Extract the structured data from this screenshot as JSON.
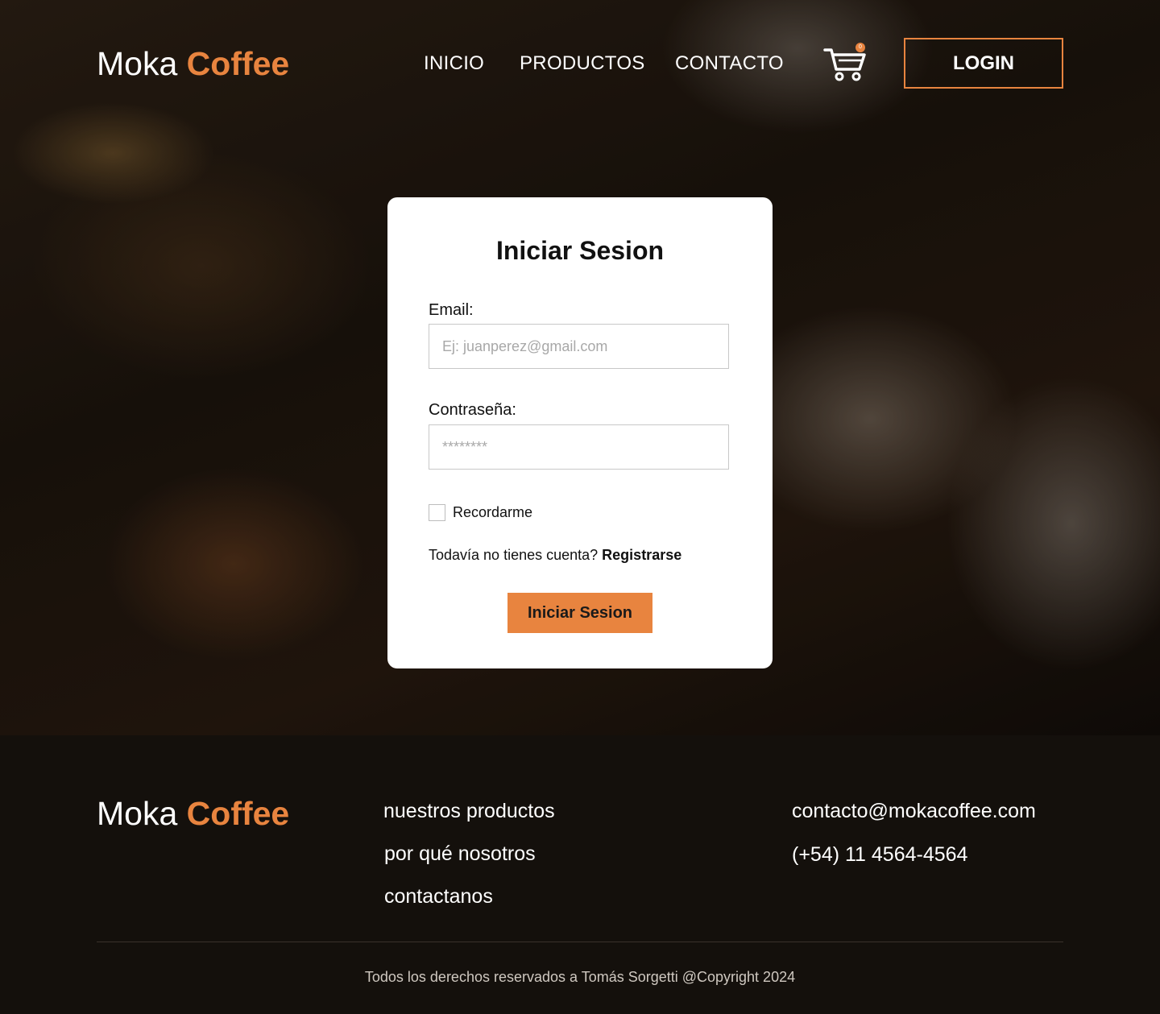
{
  "brand": {
    "word1": "Moka",
    "word2": "Coffee",
    "accent_color": "#e8843f"
  },
  "nav": {
    "items": [
      {
        "label": "INICIO"
      },
      {
        "label": "PRODUCTOS"
      },
      {
        "label": "CONTACTO"
      }
    ],
    "cart_icon": "cart-icon",
    "cart_count": "0",
    "login_label": "LOGIN"
  },
  "login": {
    "title": "Iniciar Sesion",
    "email_label": "Email:",
    "email_placeholder": "Ej: juanperez@gmail.com",
    "password_label": "Contraseña:",
    "password_placeholder": "********",
    "remember_label": "Recordarme",
    "no_account_text": "Todavía no tienes cuenta?",
    "register_link": "Registrarse",
    "submit_label": "Iniciar Sesion"
  },
  "footer": {
    "links": [
      {
        "label": "nuestros productos"
      },
      {
        "label": "por qué nosotros"
      },
      {
        "label": "contactanos"
      }
    ],
    "contact": {
      "email": "contacto@mokacoffee.com",
      "phone": "(+54) 11 4564-4564"
    },
    "copyright": "Todos los derechos reservados a Tomás Sorgetti @Copyright 2024"
  }
}
